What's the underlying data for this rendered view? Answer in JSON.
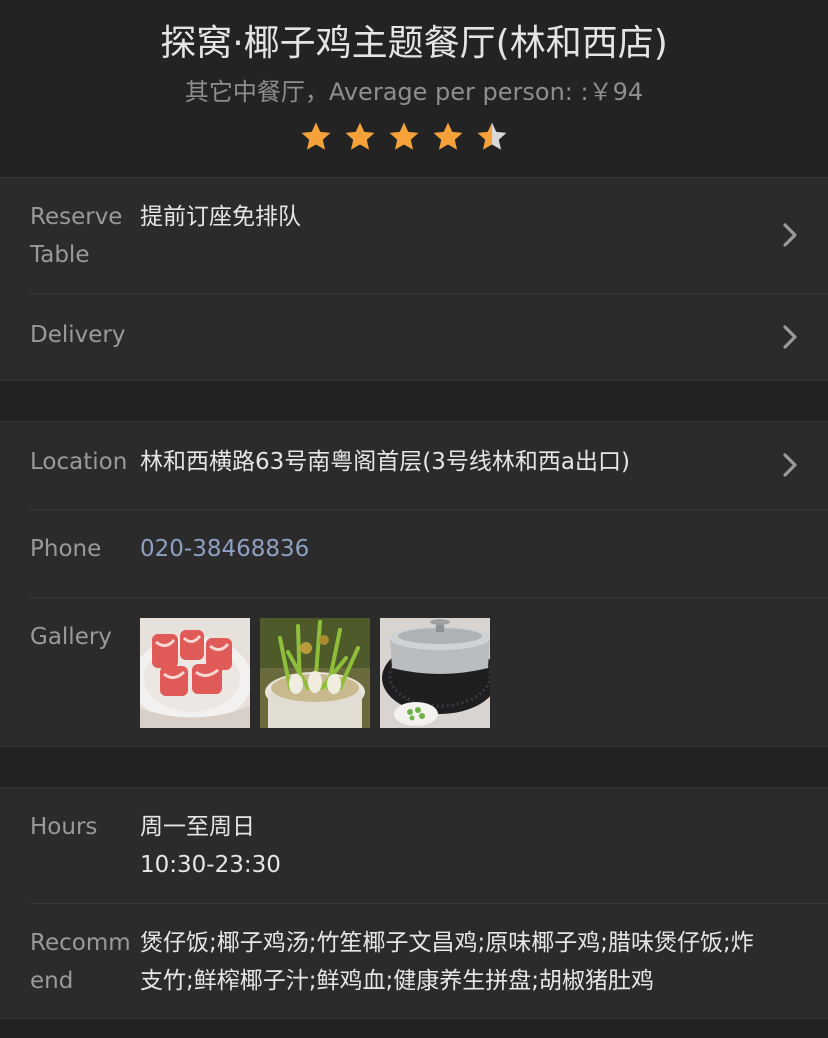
{
  "header": {
    "title": "探窝·椰子鸡主题餐厅(林和西店)",
    "subtitle": "其它中餐厅，Average per person: :￥94",
    "rating": 4.5,
    "star_color": "#f5a23a",
    "star_empty_color": "#d8d8d8"
  },
  "booking": {
    "reserve_label": "Reserve Table",
    "reserve_value": "提前订座免排队",
    "delivery_label": "Delivery"
  },
  "info": {
    "location_label": "Location",
    "location_value": "林和西横路63号南粤阁首层(3号线林和西a出口)",
    "phone_label": "Phone",
    "phone_value": "020-38468836",
    "phone_color": "#8ea1c2",
    "gallery_label": "Gallery",
    "gallery_items": [
      "sliced-meat-photo",
      "coconut-chicken-pot-photo",
      "steel-hotpot-photo"
    ]
  },
  "details": {
    "hours_label": "Hours",
    "hours_days": "周一至周日",
    "hours_time": "10:30-23:30",
    "recommend_label": "Recommend",
    "recommend_value": "煲仔饭;椰子鸡汤;竹笙椰子文昌鸡;原味椰子鸡;腊味煲仔饭;炸支竹;鲜榨椰子汁;鲜鸡血;健康养生拼盘;胡椒猪肚鸡"
  }
}
